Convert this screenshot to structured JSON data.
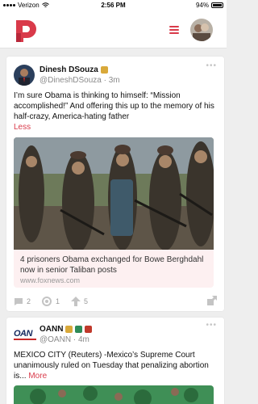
{
  "status_bar": {
    "carrier": "Verizon",
    "time": "2:56 PM",
    "battery": "94%"
  },
  "posts": [
    {
      "display_name": "Dinesh DSouza",
      "handle": "@DineshDSouza",
      "timestamp": "3m",
      "text": "I’m sure Obama is thinking to himself: “Mission accomplished!” And offering this up to the memory of his half-crazy, America-hating father",
      "toggle_label": "Less",
      "link": {
        "title": "4 prisoners Obama exchanged for Bowe Berghdahl now in senior Taliban posts",
        "domain": "www.foxnews.com"
      },
      "actions": {
        "comments": "2",
        "echoes": "1",
        "upvotes": "5"
      }
    },
    {
      "display_name": "OANN",
      "handle": "@OANN",
      "timestamp": "4m",
      "text": "MEXICO CITY (Reuters) -Mexico’s Supreme Court unanimously ruled on Tuesday that penalizing abortion is...",
      "toggle_label": "More",
      "logo_text": "OAN"
    }
  ],
  "colors": {
    "accent": "#d93a4a",
    "badge_gold": "#d9a93a",
    "badge_green": "#2e8b57",
    "badge_red": "#c0392b"
  }
}
